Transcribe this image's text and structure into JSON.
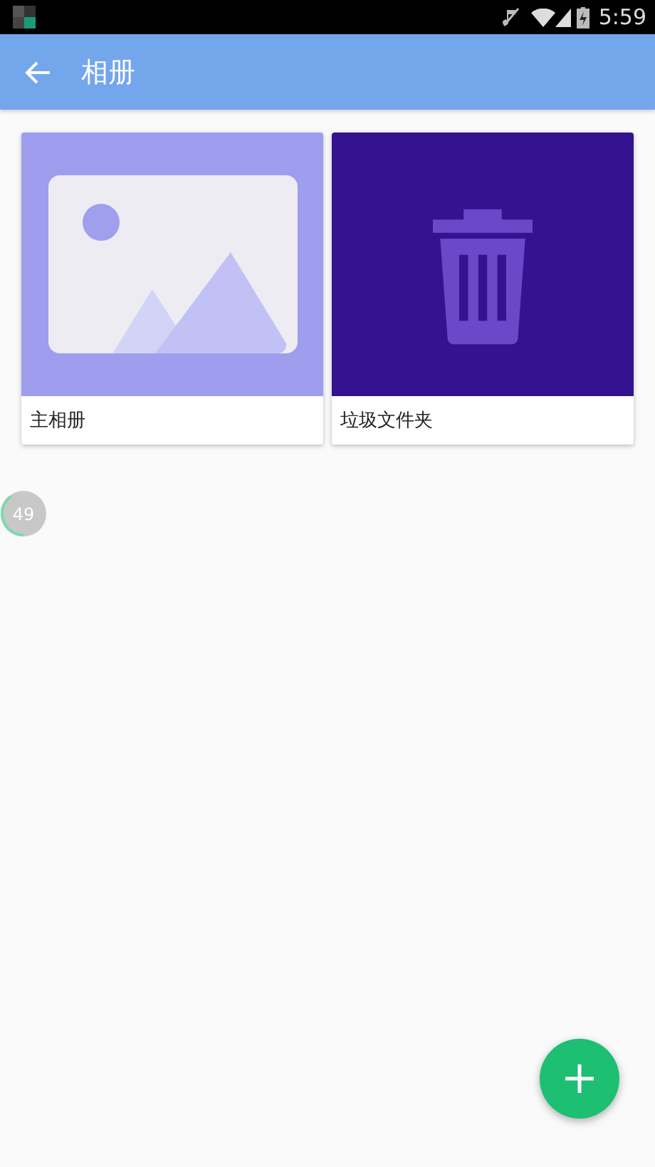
{
  "status_bar": {
    "time": "5:59"
  },
  "toolbar": {
    "title": "相册"
  },
  "albums": [
    {
      "kind": "gallery",
      "name": "主相册"
    },
    {
      "kind": "trash",
      "name": "垃圾文件夹"
    }
  ],
  "progress_badge": {
    "text": "49",
    "level": 0.4
  }
}
